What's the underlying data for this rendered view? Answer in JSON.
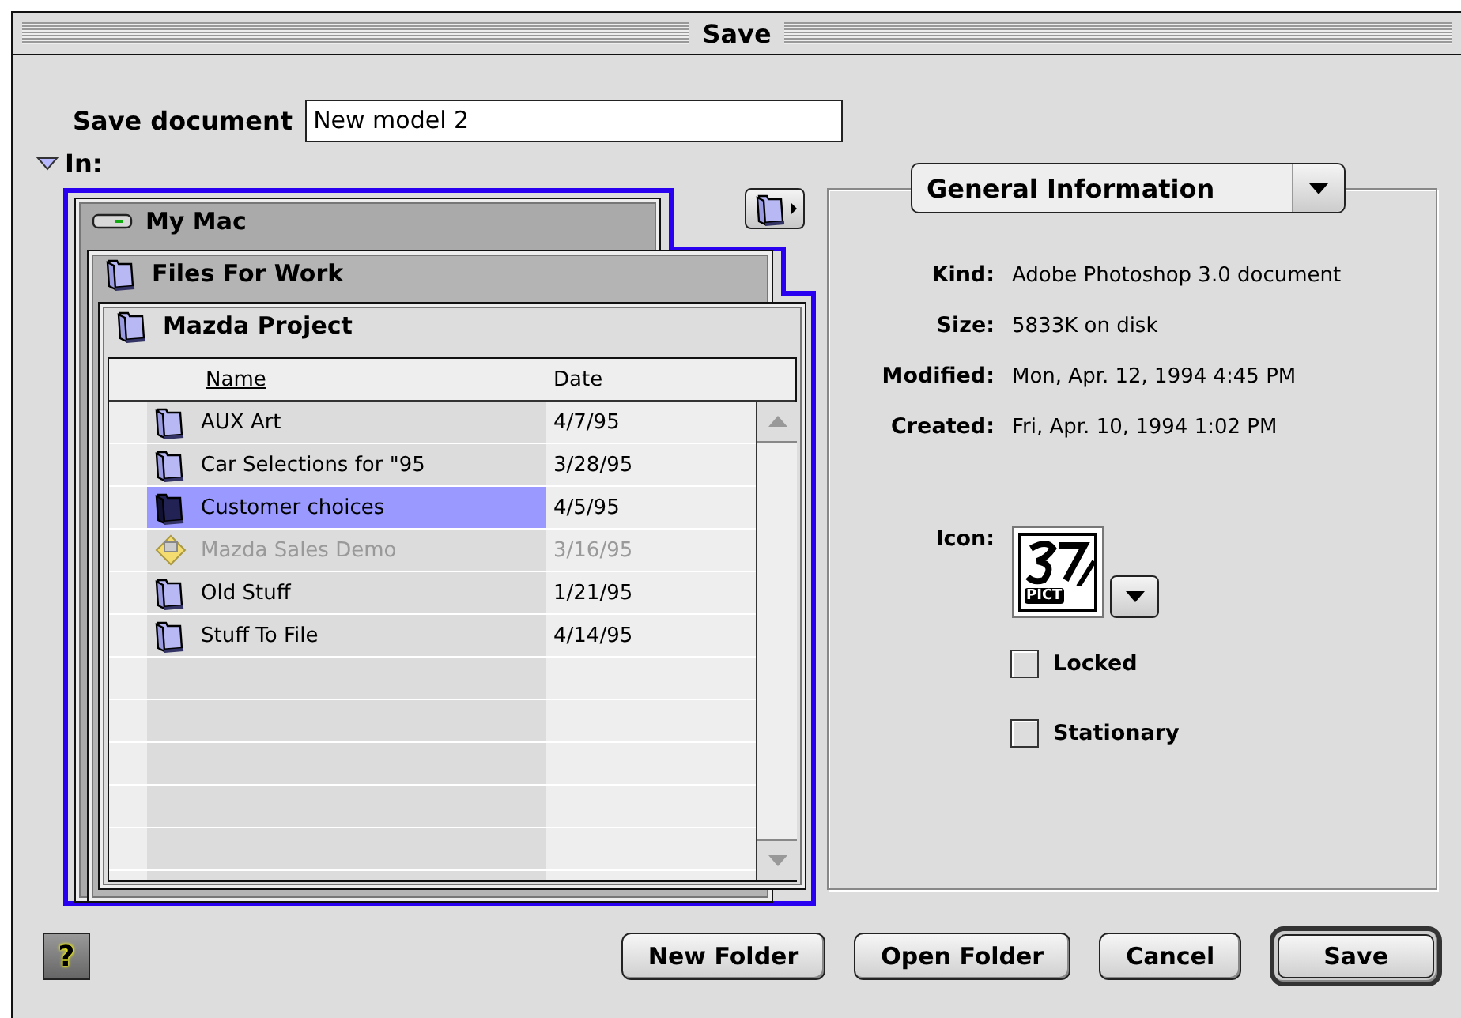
{
  "window": {
    "title": "Save"
  },
  "save_as": {
    "label": "Save document",
    "value": "New model 2"
  },
  "location": {
    "label": "In:",
    "expanded": true
  },
  "folder_path": [
    {
      "name": "My Mac",
      "kind": "disk"
    },
    {
      "name": "Files For Work",
      "kind": "folder"
    },
    {
      "name": "Mazda Project",
      "kind": "folder"
    }
  ],
  "file_list": {
    "columns": [
      {
        "label": "Name",
        "sorted": true
      },
      {
        "label": "Date",
        "sorted": false
      }
    ],
    "rows": [
      {
        "name": "AUX Art",
        "date": "4/7/95",
        "kind": "folder",
        "selected": false,
        "disabled": false
      },
      {
        "name": "Car Selections for \"95",
        "date": "3/28/95",
        "kind": "folder",
        "selected": false,
        "disabled": false
      },
      {
        "name": "Customer choices",
        "date": "4/5/95",
        "kind": "folder",
        "selected": true,
        "disabled": false
      },
      {
        "name": "Mazda Sales Demo",
        "date": "3/16/95",
        "kind": "application",
        "selected": false,
        "disabled": true
      },
      {
        "name": "Old Stuff",
        "date": "1/21/95",
        "kind": "folder",
        "selected": false,
        "disabled": false
      },
      {
        "name": "Stuff To File",
        "date": "4/14/95",
        "kind": "folder",
        "selected": false,
        "disabled": false
      }
    ]
  },
  "info_panel": {
    "menu": "General Information",
    "fields": [
      {
        "label": "Kind:",
        "value": "Adobe Photoshop 3.0 document"
      },
      {
        "label": "Size:",
        "value": "5833K on disk"
      },
      {
        "label": "Modified:",
        "value": "Mon, Apr. 12, 1994 4:45 PM"
      },
      {
        "label": "Created:",
        "value": "Fri, Apr. 10, 1994 1:02 PM"
      }
    ],
    "icon_label": "Icon:",
    "icon_badge": "PICT",
    "options": [
      {
        "label": "Locked",
        "checked": false
      },
      {
        "label": "Stationary",
        "checked": false
      }
    ]
  },
  "help_button": "?",
  "buttons": [
    {
      "label": "New Folder",
      "default": false
    },
    {
      "label": "Open Folder",
      "default": false
    },
    {
      "label": "Cancel",
      "default": false
    },
    {
      "label": "Save",
      "default": true
    }
  ]
}
